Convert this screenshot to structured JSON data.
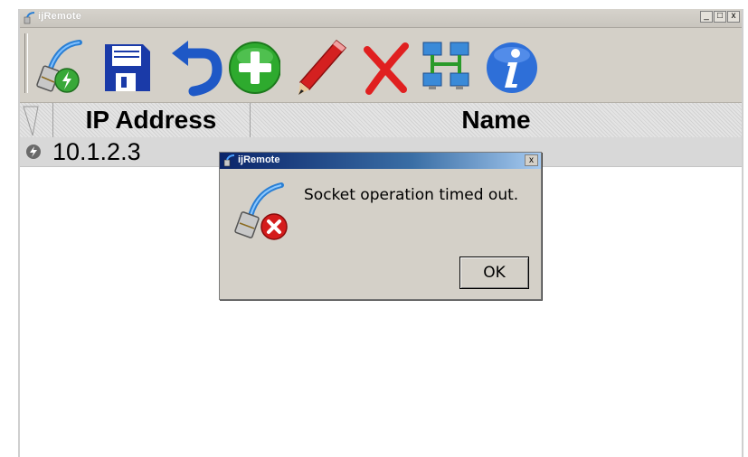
{
  "window": {
    "title": "ijRemote",
    "buttons": {
      "minimize": "_",
      "maximize": "□",
      "close": "x"
    }
  },
  "toolbar": {
    "items": [
      {
        "icon": "connect-icon"
      },
      {
        "icon": "save-icon"
      },
      {
        "icon": "undo-icon"
      },
      {
        "icon": "add-icon"
      },
      {
        "icon": "edit-icon"
      },
      {
        "icon": "delete-icon"
      },
      {
        "icon": "network-icon"
      },
      {
        "icon": "info-icon"
      }
    ]
  },
  "grid": {
    "columns": [
      "IP Address",
      "Name"
    ],
    "rows": [
      {
        "icon": "status-icon",
        "ip": "10.1.2.3",
        "name": ""
      }
    ]
  },
  "dialog": {
    "title": "ijRemote",
    "close_label": "x",
    "message": "Socket operation timed out.",
    "ok_label": "OK",
    "icon": "connection-error-icon"
  },
  "colors": {
    "dialog_title": "#0a246a",
    "save_blue": "#1a3aa8",
    "add_green": "#2eaa2e",
    "delete_red": "#e02020",
    "info_blue": "#2e6fd8"
  }
}
